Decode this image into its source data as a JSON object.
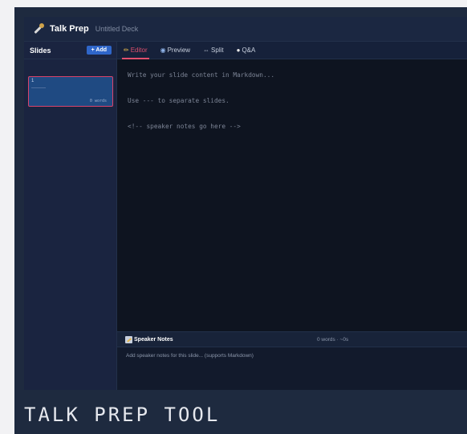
{
  "header": {
    "app_name": "Talk Prep",
    "deck_name": "Untitled Deck",
    "icon": "microphone-icon"
  },
  "sidebar": {
    "title": "Slides",
    "add_label": "+ Add",
    "slides": [
      {
        "number": "1",
        "words": "0 words"
      }
    ]
  },
  "tabs": [
    {
      "label": "Editor",
      "icon": "pencil-icon",
      "active": true
    },
    {
      "label": "Preview",
      "icon": "eye-icon",
      "active": false
    },
    {
      "label": "Split",
      "icon": "split-icon",
      "active": false
    },
    {
      "label": "Q&A",
      "icon": "chat-bubble-icon",
      "active": false
    }
  ],
  "editor": {
    "lines": [
      "Write your slide content in Markdown...",
      "Use --- to separate slides.",
      "<!-- speaker notes go here -->"
    ]
  },
  "notes": {
    "title": "Speaker Notes",
    "stats": "0 words  ·  ~0s",
    "placeholder": "Add speaker notes for this slide... (supports Markdown)"
  },
  "caption": "TALK PREP TOOL",
  "colors": {
    "accent": "#e0506e",
    "primary_button": "#2f66c9",
    "background": "#0e1420"
  }
}
